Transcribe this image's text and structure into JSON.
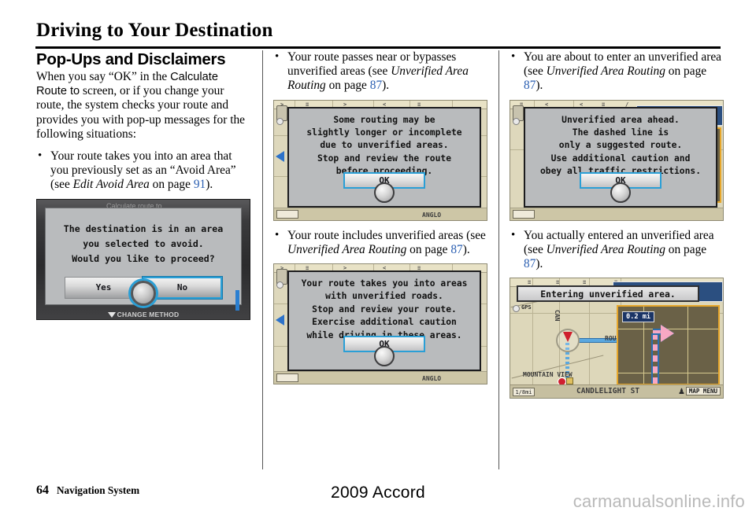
{
  "page": {
    "title": "Driving to Your Destination",
    "footer_page_number": "64",
    "footer_label": "Navigation System",
    "footer_center": "2009  Accord",
    "watermark": "carmanualsonline.info",
    "link_color": "#2b5fb2"
  },
  "col1": {
    "section_heading": "Pop-Ups and Disclaimers",
    "intro": {
      "p1": "When you say “OK” in the ",
      "emph1": "Calculate Route to",
      "p2": " screen, or if you change your route, the system checks your route and provides you with pop-up messages for the following situations:"
    },
    "bullet": {
      "t1": "Your route takes you into an area that you previously set as an “Avoid Area” (see ",
      "ital": "Edit Avoid Area",
      "t2": " on page ",
      "page": "91",
      "t3": ")."
    },
    "screen": {
      "name": "avoid-area-confirm-dialog",
      "ghost_title": "Calculate route to",
      "message_lines": [
        "The destination is in an area",
        "you selected to avoid.",
        "Would you like to proceed?"
      ],
      "button_yes": "Yes",
      "button_no": "No",
      "selected_button": "No",
      "footer_hint": "CHANGE METHOD"
    }
  },
  "col2": {
    "bullet1": {
      "t1": "Your route passes near or bypasses unverified areas (see ",
      "ital": "Unverified Area Routing",
      "t2": " on page ",
      "page": "87",
      "t3": ")."
    },
    "screen1": {
      "name": "routing-longer-disclaimer-dialog",
      "message_lines": [
        "Some routing may be",
        "slightly longer or incomplete",
        "due to unverified areas.",
        "Stop and review the route",
        "before proceeding."
      ],
      "button_ok": "OK",
      "map_scale": "",
      "map_street_label": "ANGLO"
    },
    "bullet2": {
      "t1": "Your route includes unverified areas (see ",
      "ital": "Unverified Area Routing",
      "t2": " on page ",
      "page": "87",
      "t3": ")."
    },
    "screen2": {
      "name": "unverified-roads-disclaimer-dialog",
      "message_lines": [
        "Your route takes you into areas",
        "with unverified roads.",
        "Stop and review your route.",
        "Exercise additional caution",
        "while driving in these areas."
      ],
      "button_ok": "OK",
      "map_street_label": "ANGLO"
    }
  },
  "col3": {
    "bullet1": {
      "t1": "You are about to enter an unverified area (see ",
      "ital": "Unverified Area Routing",
      "t2": " on page ",
      "page": "87",
      "t3": ")."
    },
    "screen1": {
      "name": "unverified-area-ahead-dialog",
      "message_lines": [
        "Unverified area ahead.",
        "The dashed line is",
        "only a suggested route.",
        "Use additional caution and",
        "obey all traffic restrictions."
      ],
      "button_ok": "OK"
    },
    "bullet2": {
      "t1": "You actually entered an unverified area (see ",
      "ital": "Unverified Area Routing",
      "t2": " on page ",
      "page": "87",
      "t3": ")."
    },
    "screen2": {
      "name": "entering-unverified-area-map",
      "banner": "Entering unverified area.",
      "gps_label": "GPS",
      "distance_badge": "0.2 mi",
      "map_scale": "1/8mi",
      "street_current": "CANDLELIGHT ST",
      "street_cross": "ROUND",
      "street_side": "MOUNTAIN VIEW",
      "street_vertical": "CAN",
      "map_menu_button": "MAP MENU"
    }
  }
}
